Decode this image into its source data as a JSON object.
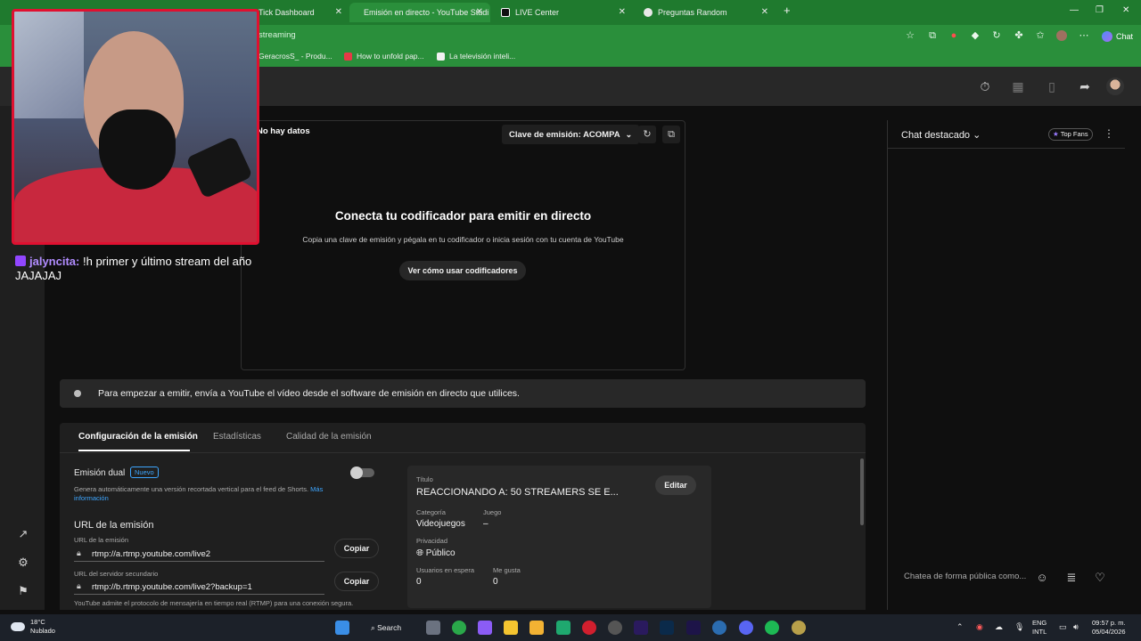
{
  "browser": {
    "tabs": [
      {
        "label": "Tick Dashboard",
        "active": false,
        "icon": "dashboard-icon"
      },
      {
        "label": "Emisión en directo - YouTube Studi",
        "active": true,
        "icon": "youtube-icon"
      },
      {
        "label": "LIVE Center",
        "active": false,
        "icon": "tiktok-icon"
      },
      {
        "label": "Preguntas Random",
        "active": false,
        "icon": "chatgpt-icon"
      }
    ],
    "address_text": "streaming",
    "chat_label": "Chat",
    "bookmarks": [
      {
        "label": "GeracrosS_ - Produ...",
        "icon": "bookmark-icon"
      },
      {
        "label": "How to unfold pap...",
        "icon": "bookmark-icon"
      },
      {
        "label": "La televisión inteli...",
        "icon": "amazon-icon"
      }
    ]
  },
  "preview": {
    "no_data": "No hay datos",
    "stream_key_label": "Clave de emisión: ACOMPA",
    "connect_title": "Conecta tu codificador para emitir en directo",
    "connect_sub": "Copia una clave de emisión y pégala en tu codificador o inicia sesión con tu cuenta de YouTube",
    "ver_button": "Ver cómo usar codificadores"
  },
  "banner": {
    "text": "Para empezar a emitir, envía a YouTube el vídeo desde el software de emisión en directo que utilices."
  },
  "settings": {
    "tabs": [
      "Configuración de la emisión",
      "Estadísticas",
      "Calidad de la emisión"
    ],
    "dual_label": "Emisión dual",
    "new_badge": "Nuevo",
    "dual_desc": "Genera automáticamente una versión recortada vertical para el feed de Shorts.",
    "more_info": "Más información",
    "url_section": "URL de la emisión",
    "url_label": "URL de la emisión",
    "url_value": "rtmp://a.rtmp.youtube.com/live2",
    "backup_label": "URL del servidor secundario",
    "backup_value": "rtmp://b.rtmp.youtube.com/live2?backup=1",
    "copy": "Copiar",
    "rtmp_note": "YouTube admite el protocolo de mensajería en tiempo real (RTMP) para una conexión segura."
  },
  "info": {
    "title_label": "Título",
    "title_value": "REACCIONANDO A: 50 STREAMERS SE E...",
    "edit": "Editar",
    "category_label": "Categoría",
    "category_value": "Videojuegos",
    "game_label": "Juego",
    "game_value": "–",
    "privacy_label": "Privacidad",
    "privacy_value": "Público",
    "waiting_label": "Usuarios en espera",
    "waiting_value": "0",
    "likes_label": "Me gusta",
    "likes_value": "0"
  },
  "chat": {
    "title": "Chat destacado",
    "top_fans": "Top Fans",
    "placeholder": "Chatea de forma pública como..."
  },
  "overlay": {
    "username": "jalyncita:",
    "message": "!h primer y último stream del año JAJAJAJ"
  },
  "taskbar": {
    "temperature": "18°C",
    "weather": "Nublado",
    "search": "Search",
    "lang_top": "ENG",
    "lang_bottom": "INTL",
    "time": "09:57 p. m.",
    "date": "05/04/2026"
  },
  "colors": {
    "browser_green": "#2a8f3b",
    "webcam_border": "#e01030",
    "link_blue": "#3ea6ff",
    "twitch_purple": "#9146ff"
  }
}
